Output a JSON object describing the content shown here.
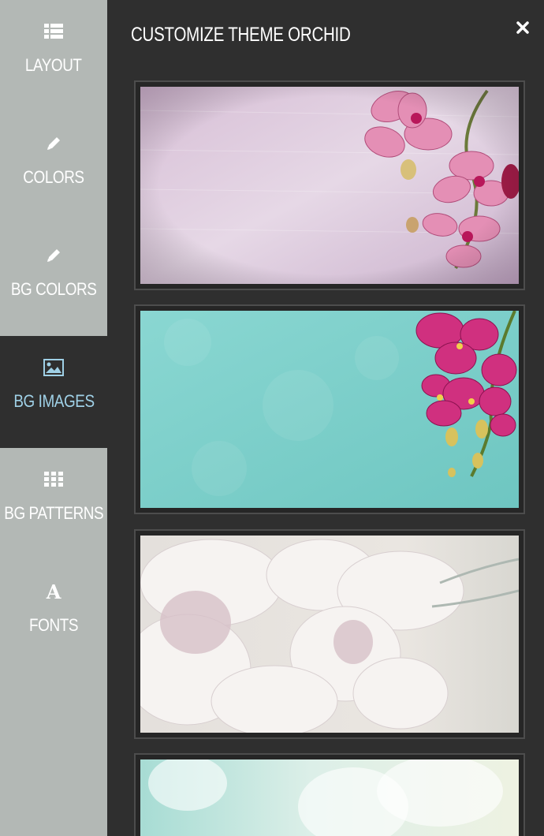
{
  "panel": {
    "title": "CUSTOMIZE THEME ORCHID",
    "close_icon": "close-icon"
  },
  "sidebar": {
    "items": [
      {
        "label": "LAYOUT",
        "icon": "list-icon",
        "active": false
      },
      {
        "label": "COLORS",
        "icon": "pencil-icon",
        "active": false
      },
      {
        "label": "BG COLORS",
        "icon": "pencil-icon",
        "active": false
      },
      {
        "label": "BG IMAGES",
        "icon": "image-icon",
        "active": true
      },
      {
        "label": "BG PATTERNS",
        "icon": "grid-icon",
        "active": false
      },
      {
        "label": "FONTS",
        "icon": "font-icon",
        "active": false
      }
    ]
  },
  "bg_images": [
    {
      "subject": "pink orchid on lavender wood",
      "colors": [
        "#d9c6dc",
        "#e08cb4"
      ]
    },
    {
      "subject": "magenta orchid on turquoise",
      "colors": [
        "#7fcfca",
        "#c92a78"
      ]
    },
    {
      "subject": "white orchids soft focus",
      "colors": [
        "#e6e2df",
        "#d3c3c8"
      ]
    },
    {
      "subject": "pale orchid on mint",
      "colors": [
        "#bfe3dc",
        "#f0f2e8"
      ]
    }
  ],
  "colors": {
    "sidebar_bg": "#b3b8b5",
    "panel_bg": "#2f2f2f",
    "active_label": "#9fd0e6"
  }
}
